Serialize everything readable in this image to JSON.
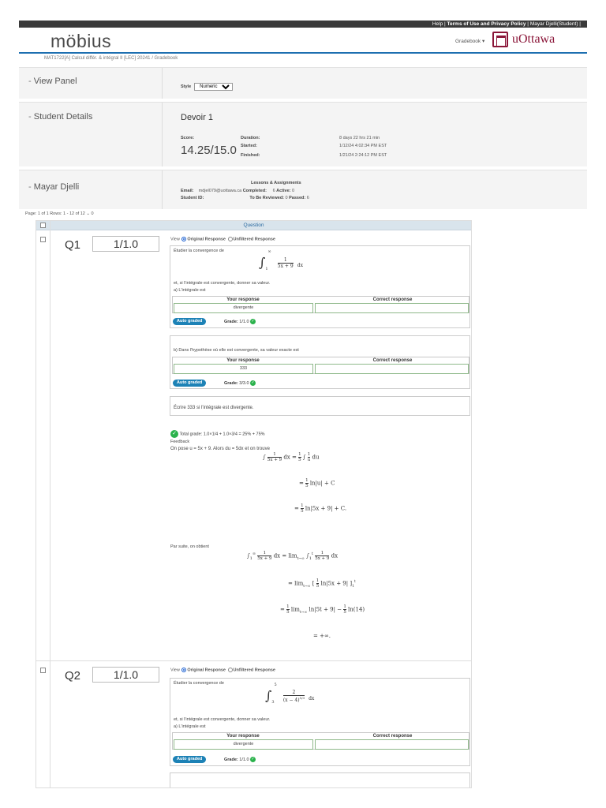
{
  "topbar": {
    "help": "Help",
    "terms": "Terms of Use and Privacy Policy",
    "user": "Mayar Djelli(Student)"
  },
  "header": {
    "logo": "möbius",
    "gradebook_menu": "Gradebook ▾",
    "institution": "uOttawa"
  },
  "breadcrumb": {
    "course": "MAT1722[A] Calcul différ. & intégral II [LEC] 20241",
    "sep": "/",
    "current": "Gradebook"
  },
  "view_panel": {
    "title": "View Panel",
    "style_label": "Style",
    "style_value": "Numeric"
  },
  "student_details": {
    "title": "Student Details",
    "assignment": "Devoir 1",
    "score_label": "Score:",
    "score": "14.25/15.0",
    "duration_label": "Duration:",
    "duration": "8 days 22 hrs 21 min",
    "started_label": "Started:",
    "started": "1/12/24 4:02:34 PM EST",
    "finished_label": "Finished:",
    "finished": "1/21/24 2:24:12 PM EST"
  },
  "student": {
    "name": "Mayar Djelli",
    "lessons_header": "Lessons & Assignments",
    "email_label": "Email:",
    "email": "mdjel079@uottawa.ca",
    "id_label": "Student ID:",
    "completed_label": "Completed:",
    "completed": "6",
    "active_label": "Active:",
    "active": "0",
    "review_label": "To Be Reviewed:",
    "review": "0",
    "passed_label": "Passed:",
    "passed": "6"
  },
  "page_info": "Page: 1 of 1 Rows: 1 - 12 of 12  ⌄  0",
  "table": {
    "header": "Question"
  },
  "view": {
    "label": "View",
    "original": "Original Response",
    "unfiltered": "Unfiltered Response"
  },
  "q1": {
    "label": "Q1",
    "score": "1/1.0",
    "intro": "Étudier la convergence de",
    "cond": "et, si l'intégrale est convergente, donner sa valeur.",
    "part_a": "a) L'intégrale est",
    "your_response": "Your response",
    "correct_response": "Correct response",
    "a_value": "divergente",
    "auto": "Auto graded",
    "a_grade_label": "Grade:",
    "a_grade": "1/1.0",
    "part_b": "b) Dans l'hypothèse où elle est convergente, sa valeur exacte est",
    "b_value": "333",
    "b_grade": "3/3.0",
    "note": "Écrire 333 si l'intégrale est divergente.",
    "total": "Total grade: 1.0×1/4 + 1.0×3/4 = 25% + 75%",
    "feedback": "Feedback",
    "fb_line": "On pose u = 5x + 9. Alors du = 5dx et on trouve",
    "par_suite": "Par suite, on obtient"
  },
  "q2": {
    "label": "Q2",
    "score": "1/1.0",
    "intro": "Étudier la convergence de",
    "cond": "et, si l'intégrale est convergente, donner sa valeur.",
    "part_a": "a) L'intégrale est",
    "your_response": "Your response",
    "correct_response": "Correct response",
    "a_value": "divergente",
    "auto": "Auto graded",
    "a_grade_label": "Grade:",
    "a_grade": "1/1.0"
  }
}
